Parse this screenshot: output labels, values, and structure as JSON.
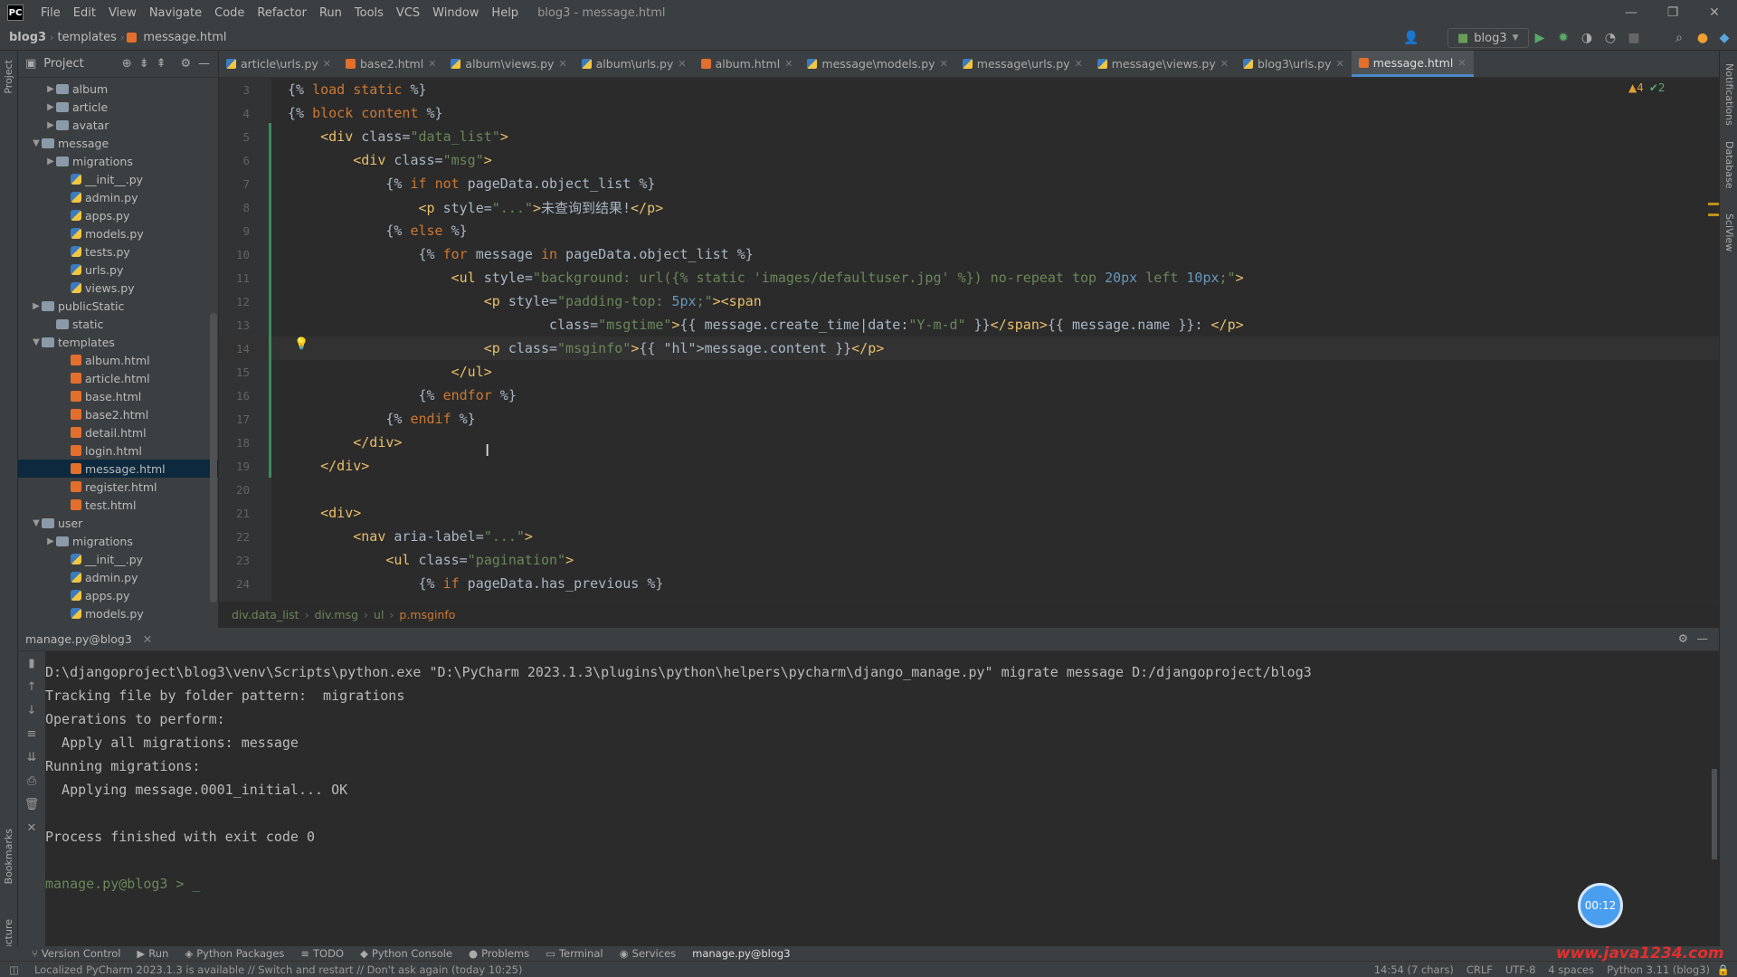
{
  "app": {
    "logo": "PC",
    "window_title": "blog3 - message.html",
    "menu": [
      "File",
      "Edit",
      "View",
      "Navigate",
      "Code",
      "Refactor",
      "Run",
      "Tools",
      "VCS",
      "Window",
      "Help"
    ]
  },
  "breadcrumb": {
    "project": "blog3",
    "folder": "templates",
    "file": "message.html"
  },
  "run_config": {
    "label": "blog3"
  },
  "project_panel": {
    "title": "Project",
    "items": [
      {
        "label": "album",
        "kind": "folder",
        "depth": 1,
        "expand": "▶"
      },
      {
        "label": "article",
        "kind": "folder",
        "depth": 1,
        "expand": "▶"
      },
      {
        "label": "avatar",
        "kind": "folder",
        "depth": 1,
        "expand": "▶"
      },
      {
        "label": "message",
        "kind": "folder",
        "depth": 0,
        "expand": "▼"
      },
      {
        "label": "migrations",
        "kind": "folder",
        "depth": 1,
        "expand": "▶"
      },
      {
        "label": "__init__.py",
        "kind": "py",
        "depth": 2,
        "expand": ""
      },
      {
        "label": "admin.py",
        "kind": "py",
        "depth": 2,
        "expand": ""
      },
      {
        "label": "apps.py",
        "kind": "py",
        "depth": 2,
        "expand": ""
      },
      {
        "label": "models.py",
        "kind": "py",
        "depth": 2,
        "expand": ""
      },
      {
        "label": "tests.py",
        "kind": "py",
        "depth": 2,
        "expand": ""
      },
      {
        "label": "urls.py",
        "kind": "py",
        "depth": 2,
        "expand": ""
      },
      {
        "label": "views.py",
        "kind": "py",
        "depth": 2,
        "expand": ""
      },
      {
        "label": "publicStatic",
        "kind": "folder",
        "depth": 0,
        "expand": "▶"
      },
      {
        "label": "static",
        "kind": "folder",
        "depth": 1,
        "expand": ""
      },
      {
        "label": "templates",
        "kind": "folder",
        "depth": 0,
        "expand": "▼"
      },
      {
        "label": "album.html",
        "kind": "html",
        "depth": 2,
        "expand": ""
      },
      {
        "label": "article.html",
        "kind": "html",
        "depth": 2,
        "expand": ""
      },
      {
        "label": "base.html",
        "kind": "html",
        "depth": 2,
        "expand": ""
      },
      {
        "label": "base2.html",
        "kind": "html",
        "depth": 2,
        "expand": ""
      },
      {
        "label": "detail.html",
        "kind": "html",
        "depth": 2,
        "expand": ""
      },
      {
        "label": "login.html",
        "kind": "html",
        "depth": 2,
        "expand": ""
      },
      {
        "label": "message.html",
        "kind": "html",
        "depth": 2,
        "expand": "",
        "selected": true
      },
      {
        "label": "register.html",
        "kind": "html",
        "depth": 2,
        "expand": ""
      },
      {
        "label": "test.html",
        "kind": "html",
        "depth": 2,
        "expand": ""
      },
      {
        "label": "user",
        "kind": "folder",
        "depth": 0,
        "expand": "▼"
      },
      {
        "label": "migrations",
        "kind": "folder",
        "depth": 1,
        "expand": "▶"
      },
      {
        "label": "__init__.py",
        "kind": "py",
        "depth": 2,
        "expand": ""
      },
      {
        "label": "admin.py",
        "kind": "py",
        "depth": 2,
        "expand": ""
      },
      {
        "label": "apps.py",
        "kind": "py",
        "depth": 2,
        "expand": ""
      },
      {
        "label": "models.py",
        "kind": "py",
        "depth": 2,
        "expand": ""
      }
    ]
  },
  "tabs": [
    {
      "label": "article\\urls.py",
      "kind": "py"
    },
    {
      "label": "base2.html",
      "kind": "html"
    },
    {
      "label": "album\\views.py",
      "kind": "py"
    },
    {
      "label": "album\\urls.py",
      "kind": "py"
    },
    {
      "label": "album.html",
      "kind": "html"
    },
    {
      "label": "message\\models.py",
      "kind": "py"
    },
    {
      "label": "message\\urls.py",
      "kind": "py"
    },
    {
      "label": "message\\views.py",
      "kind": "py"
    },
    {
      "label": "blog3\\urls.py",
      "kind": "py"
    },
    {
      "label": "message.html",
      "kind": "html",
      "active": true
    }
  ],
  "inspection": {
    "warnings": "▲4",
    "ok": "✔2"
  },
  "code_lines": [
    {
      "n": "3",
      "html": "{% load static %}"
    },
    {
      "n": "4",
      "html": "{% block content %}"
    },
    {
      "n": "5",
      "html": "    <div class=\"data_list\">"
    },
    {
      "n": "6",
      "html": "        <div class=\"msg\">"
    },
    {
      "n": "7",
      "html": "            {% if not pageData.object_list %}"
    },
    {
      "n": "8",
      "html": "                <p style=\"...\">未查询到结果!</p>"
    },
    {
      "n": "9",
      "html": "            {% else %}"
    },
    {
      "n": "10",
      "html": "                {% for message in pageData.object_list %}"
    },
    {
      "n": "11",
      "html": "                    <ul style=\"background: url({% static 'images/defaultuser.jpg' %}) no-repeat top 20px left 10px;\">"
    },
    {
      "n": "12",
      "html": "                        <p style=\"padding-top: 5px;\"><span"
    },
    {
      "n": "13",
      "html": "                                class=\"msgtime\">{{ message.create_time|date:\"Y-m-d\" }}</span>{{ message.name }}: </p>"
    },
    {
      "n": "14",
      "html": "                        <p class=\"msginfo\">{{ message.content }}</p>"
    },
    {
      "n": "15",
      "html": "                    </ul>"
    },
    {
      "n": "16",
      "html": "                {% endfor %}"
    },
    {
      "n": "17",
      "html": "            {% endif %}"
    },
    {
      "n": "18",
      "html": "        </div>"
    },
    {
      "n": "19",
      "html": "    </div>"
    },
    {
      "n": "20",
      "html": ""
    },
    {
      "n": "21",
      "html": "    <div>"
    },
    {
      "n": "22",
      "html": "        <nav aria-label=\"...\">"
    },
    {
      "n": "23",
      "html": "            <ul class=\"pagination\">"
    },
    {
      "n": "24",
      "html": "                {% if pageData.has_previous %}"
    }
  ],
  "editor_breadcrumb": [
    "div.data_list",
    "div.msg",
    "ul",
    "p.msginfo"
  ],
  "run_panel": {
    "tab": "manage.py@blog3"
  },
  "console": [
    "D:\\djangoproject\\blog3\\venv\\Scripts\\python.exe \"D:\\PyCharm 2023.1.3\\plugins\\python\\helpers\\pycharm\\django_manage.py\" migrate message D:/djangoproject/blog3",
    "Tracking file by folder pattern:  migrations",
    "Operations to perform:",
    "  Apply all migrations: message",
    "Running migrations:",
    "  Applying message.0001_initial... OK",
    "",
    "Process finished with exit code 0",
    "",
    "manage.py@blog3 > _"
  ],
  "timer": "00:12",
  "toolwindows": [
    {
      "label": "Version Control",
      "icon": "⑂"
    },
    {
      "label": "Run",
      "icon": "▶"
    },
    {
      "label": "Python Packages",
      "icon": "◈"
    },
    {
      "label": "TODO",
      "icon": "≡"
    },
    {
      "label": "Python Console",
      "icon": "◆"
    },
    {
      "label": "Problems",
      "icon": "●"
    },
    {
      "label": "Terminal",
      "icon": "▭"
    },
    {
      "label": "Services",
      "icon": "◉"
    },
    {
      "label": "manage.py@blog3",
      "icon": "",
      "active": true
    }
  ],
  "status": {
    "message": "Localized PyCharm 2023.1.3 is available // Switch and restart // Don't ask again (today 10:25)",
    "position": "14:54 (7 chars)",
    "line_sep": "CRLF",
    "encoding": "UTF-8",
    "indent": "4 spaces",
    "interpreter": "Python 3.11 (blog3)"
  },
  "watermark": "www.java1234.com",
  "colors": {
    "accent": "#4a88c7",
    "tag": "#e8bf6a",
    "string": "#6a8759",
    "keyword": "#cc7832",
    "selection": "#214283"
  }
}
